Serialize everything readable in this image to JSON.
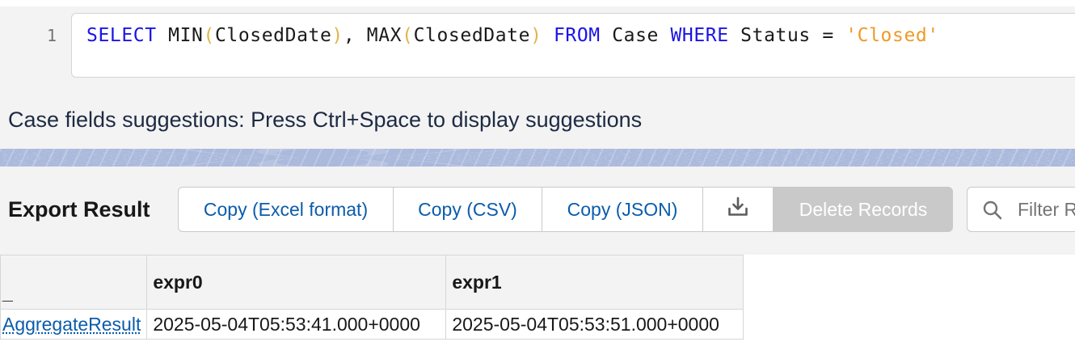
{
  "editor": {
    "line_number": "1",
    "query": {
      "select_kw": "SELECT",
      "min_fn": "MIN",
      "min_open": "(",
      "min_arg": "ClosedDate",
      "min_close": ")",
      "comma": ", ",
      "max_fn": "MAX",
      "max_open": "(",
      "max_arg": "ClosedDate",
      "max_close": ")",
      "from_kw": "FROM",
      "object": "Case",
      "where_kw": "WHERE",
      "field": "Status",
      "operator": "=",
      "value": "'Closed'"
    }
  },
  "hint": {
    "text": "Case fields suggestions: Press Ctrl+Space to display suggestions"
  },
  "toolbar": {
    "export_label": "Export Result",
    "copy_excel_label": "Copy (Excel format)",
    "copy_csv_label": "Copy (CSV)",
    "copy_json_label": "Copy (JSON)",
    "download_icon": "download-icon",
    "delete_label": "Delete Records",
    "filter_placeholder": "Filter Results"
  },
  "results": {
    "columns": [
      "_",
      "expr0",
      "expr1"
    ],
    "rows": [
      [
        "AggregateResult",
        "2025-05-04T05:53:41.000+0000",
        "2025-05-04T05:53:51.000+0000"
      ]
    ]
  },
  "colors": {
    "keyword": "#1a14e6",
    "paren": "#e0b54a",
    "string": "#ef9a26",
    "link": "#0b5cab",
    "divider": "#aab9dc",
    "disabled_button": "#c9c9c9"
  }
}
